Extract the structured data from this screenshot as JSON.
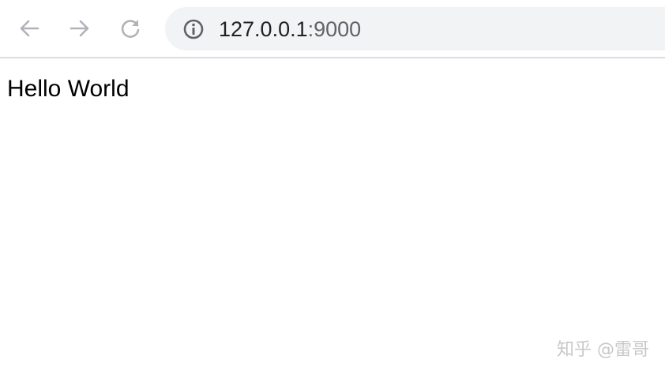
{
  "browser": {
    "nav": {
      "back_icon": "arrow-left-icon",
      "forward_icon": "arrow-right-icon",
      "reload_icon": "reload-icon"
    },
    "address_bar": {
      "site_info_icon": "info-circle-icon",
      "url_host": "127.0.0.1",
      "url_port": ":9000"
    }
  },
  "page": {
    "body_text": "Hello World"
  },
  "watermark": {
    "text": "知乎 @雷哥"
  },
  "colors": {
    "nav_icon": "#b0b3b8",
    "omnibox_bg": "#f1f3f4",
    "info_icon": "#5f6368",
    "toolbar_border": "#dadce0",
    "watermark": "#c8c8c8"
  }
}
